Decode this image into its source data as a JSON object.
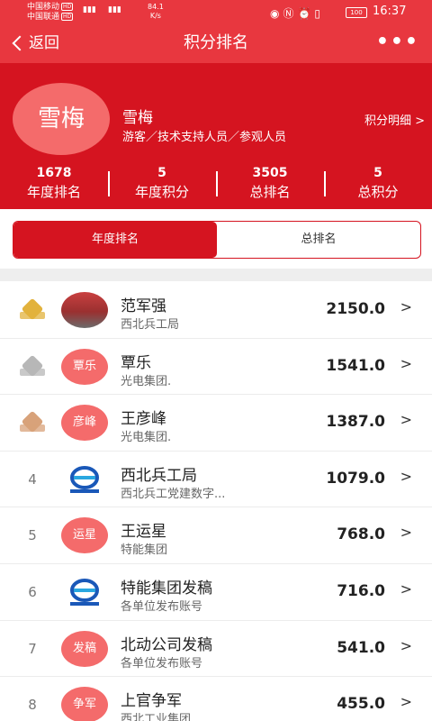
{
  "status_bar": {
    "carrier1": "中国移动",
    "carrier2": "中国联通",
    "hd": "HD",
    "net_speed": "84.1",
    "net_unit": "K/s",
    "battery": "100",
    "time": "16:37"
  },
  "header": {
    "back_label": "返回",
    "title": "积分排名",
    "more_icon": "more-dots-icon"
  },
  "profile": {
    "avatar_text": "雪梅",
    "name": "雪梅",
    "roles": "游客／技术支持人员／参观人员",
    "points_detail": "积分明细 >"
  },
  "stats": [
    {
      "value": "1678",
      "label": "年度排名"
    },
    {
      "value": "5",
      "label": "年度积分"
    },
    {
      "value": "3505",
      "label": "总排名"
    },
    {
      "value": "5",
      "label": "总积分"
    }
  ],
  "tabs": [
    {
      "label": "年度排名",
      "active": true
    },
    {
      "label": "总排名",
      "active": false
    }
  ],
  "ranking": [
    {
      "rank": "1",
      "medal": "gold",
      "avatar_type": "photo",
      "avatar_text": "",
      "name": "范军强",
      "org": "西北兵工局",
      "score": "2150.0"
    },
    {
      "rank": "2",
      "medal": "silver",
      "avatar_type": "text",
      "avatar_text": "覃乐",
      "name": "覃乐",
      "org": "光电集团.",
      "score": "1541.0"
    },
    {
      "rank": "3",
      "medal": "bronze",
      "avatar_type": "text",
      "avatar_text": "彦峰",
      "name": "王彦峰",
      "org": "光电集团.",
      "score": "1387.0"
    },
    {
      "rank": "4",
      "medal": "",
      "avatar_type": "logo",
      "avatar_text": "",
      "name": "西北兵工局",
      "org": "西北兵工党建数字...",
      "score": "1079.0"
    },
    {
      "rank": "5",
      "medal": "",
      "avatar_type": "text",
      "avatar_text": "运星",
      "name": "王运星",
      "org": "特能集团",
      "score": "768.0"
    },
    {
      "rank": "6",
      "medal": "",
      "avatar_type": "logo",
      "avatar_text": "",
      "name": "特能集团发稿",
      "org": "各单位发布账号",
      "score": "716.0"
    },
    {
      "rank": "7",
      "medal": "",
      "avatar_type": "text",
      "avatar_text": "发稿",
      "name": "北动公司发稿",
      "org": "各单位发布账号",
      "score": "541.0"
    },
    {
      "rank": "8",
      "medal": "",
      "avatar_type": "text",
      "avatar_text": "争军",
      "name": "上官争军",
      "org": "西北工业集团.",
      "score": "455.0"
    }
  ],
  "colors": {
    "primary_red": "#e8373f",
    "dark_red": "#d51420",
    "avatar_pink": "#f46b6b",
    "gold": "#e2b23c",
    "silver": "#b7b7b7",
    "bronze": "#d8a27a"
  }
}
